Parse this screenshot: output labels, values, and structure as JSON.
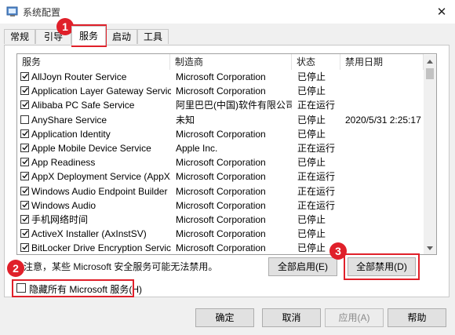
{
  "window": {
    "title": "系统配置",
    "close_glyph": "✕"
  },
  "tabs": [
    {
      "label": "常规",
      "active": false
    },
    {
      "label": "引导",
      "active": false
    },
    {
      "label": "服务",
      "active": true
    },
    {
      "label": "启动",
      "active": false
    },
    {
      "label": "工具",
      "active": false
    }
  ],
  "table": {
    "headers": [
      "服务",
      "制造商",
      "状态",
      "禁用日期"
    ],
    "rows": [
      {
        "checked": true,
        "service": "AllJoyn Router Service",
        "vendor": "Microsoft Corporation",
        "status": "已停止",
        "date": ""
      },
      {
        "checked": true,
        "service": "Application Layer Gateway Service",
        "vendor": "Microsoft Corporation",
        "status": "已停止",
        "date": ""
      },
      {
        "checked": true,
        "service": "Alibaba PC Safe Service",
        "vendor": "阿里巴巴(中国)软件有限公司",
        "status": "正在运行",
        "date": ""
      },
      {
        "checked": false,
        "service": "AnyShare Service",
        "vendor": "未知",
        "status": "已停止",
        "date": "2020/5/31 2:25:17"
      },
      {
        "checked": true,
        "service": "Application Identity",
        "vendor": "Microsoft Corporation",
        "status": "已停止",
        "date": ""
      },
      {
        "checked": true,
        "service": "Apple Mobile Device Service",
        "vendor": "Apple Inc.",
        "status": "正在运行",
        "date": ""
      },
      {
        "checked": true,
        "service": "App Readiness",
        "vendor": "Microsoft Corporation",
        "status": "已停止",
        "date": ""
      },
      {
        "checked": true,
        "service": "AppX Deployment Service (AppX...",
        "vendor": "Microsoft Corporation",
        "status": "正在运行",
        "date": ""
      },
      {
        "checked": true,
        "service": "Windows Audio Endpoint Builder",
        "vendor": "Microsoft Corporation",
        "status": "正在运行",
        "date": ""
      },
      {
        "checked": true,
        "service": "Windows Audio",
        "vendor": "Microsoft Corporation",
        "status": "正在运行",
        "date": ""
      },
      {
        "checked": true,
        "service": "手机网络时间",
        "vendor": "Microsoft Corporation",
        "status": "已停止",
        "date": ""
      },
      {
        "checked": true,
        "service": "ActiveX Installer (AxInstSV)",
        "vendor": "Microsoft Corporation",
        "status": "已停止",
        "date": ""
      },
      {
        "checked": true,
        "service": "BitLocker Drive Encryption Service",
        "vendor": "Microsoft Corporation",
        "status": "已停止",
        "date": ""
      }
    ]
  },
  "note": "注意，某些 Microsoft 安全服务可能无法禁用。",
  "buttons": {
    "enable_all": "全部启用(E)",
    "disable_all": "全部禁用(D)",
    "ok": "确定",
    "cancel": "取消",
    "apply": "应用(A)",
    "help": "帮助"
  },
  "hide_ms": {
    "label": "隐藏所有 Microsoft 服务(H)",
    "checked": false
  },
  "annotations": [
    "1",
    "2",
    "3"
  ],
  "colors": {
    "highlight": "#e0202a"
  }
}
